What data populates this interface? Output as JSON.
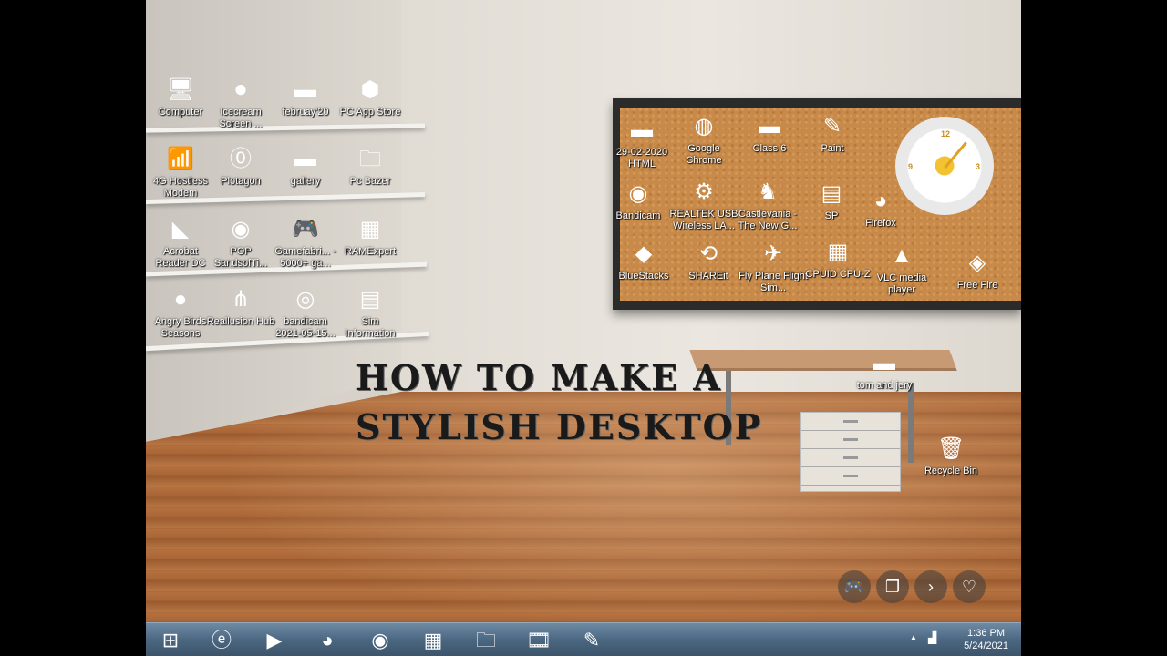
{
  "headline": {
    "line1": "HOW TO MAKE A",
    "line2": "STYLISH DESKTOP"
  },
  "shelf_icons": [
    {
      "label": "Computer",
      "glyph": "🖥",
      "icon": "computer-icon"
    },
    {
      "label": "Icecream Screen ...",
      "glyph": "⏺",
      "icon": "icecream-icon"
    },
    {
      "label": "februay'20",
      "glyph": "▬",
      "icon": "drive-icon"
    },
    {
      "label": "PC App Store",
      "glyph": "⬢",
      "icon": "app-store-icon"
    },
    {
      "label": "4G Hostless Modem",
      "glyph": "📶",
      "icon": "modem-icon"
    },
    {
      "label": "Plotagon",
      "glyph": "⓪",
      "icon": "plotagon-icon"
    },
    {
      "label": "gallery",
      "glyph": "▬",
      "icon": "drive-icon"
    },
    {
      "label": "Pc Bazer",
      "glyph": "🗀",
      "icon": "folder-icon"
    },
    {
      "label": "Acrobat Reader DC",
      "glyph": "◣",
      "icon": "acrobat-icon"
    },
    {
      "label": "POP SandsofTi...",
      "glyph": "◉",
      "icon": "pop-game-icon"
    },
    {
      "label": "Gamefabri... - 5000+ ga...",
      "glyph": "🎮",
      "icon": "gamepad-icon"
    },
    {
      "label": "RAMExpert",
      "glyph": "▦",
      "icon": "ram-icon"
    },
    {
      "label": "Angry Birds Seasons",
      "glyph": "●",
      "icon": "angry-birds-icon"
    },
    {
      "label": "Reallusion Hub",
      "glyph": "⋔",
      "icon": "reallusion-icon"
    },
    {
      "label": "bandicam 2021-05-15...",
      "glyph": "◎",
      "icon": "bandicam-file-icon"
    },
    {
      "label": "Sim Information",
      "glyph": "▤",
      "icon": "document-icon"
    }
  ],
  "board_icons": [
    {
      "label": "29-02-2020 HTML",
      "glyph": "▬",
      "icon": "drive-icon"
    },
    {
      "label": "Google Chrome",
      "glyph": "◍",
      "icon": "chrome-icon"
    },
    {
      "label": "Class 6",
      "glyph": "▬",
      "icon": "drive-icon"
    },
    {
      "label": "Paint",
      "glyph": "✎",
      "icon": "paint-icon"
    },
    {
      "label": "Bandicam",
      "glyph": "◉",
      "icon": "bandicam-icon"
    },
    {
      "label": "REALTEK USB Wireless LA...",
      "glyph": "⚙",
      "icon": "wireless-icon"
    },
    {
      "label": "Castlevania - The New G...",
      "glyph": "♞",
      "icon": "castlevania-icon"
    },
    {
      "label": "SP",
      "glyph": "▤",
      "icon": "document-icon"
    },
    {
      "label": "Firefox",
      "glyph": "◕",
      "icon": "firefox-icon"
    },
    {
      "label": "BlueStacks",
      "glyph": "◆",
      "icon": "bluestacks-icon"
    },
    {
      "label": "SHAREit",
      "glyph": "⟲",
      "icon": "shareit-icon"
    },
    {
      "label": "Fly Plane Flight Sim...",
      "glyph": "✈",
      "icon": "plane-icon"
    },
    {
      "label": "CPUID CPU-Z",
      "glyph": "▦",
      "icon": "cpuz-icon"
    },
    {
      "label": "VLC media player",
      "glyph": "▲",
      "icon": "vlc-icon"
    },
    {
      "label": "Free Fire",
      "glyph": "◈",
      "icon": "free-fire-icon"
    }
  ],
  "desk_icons": [
    {
      "label": "tom and jery",
      "glyph": "▬",
      "icon": "laptop-icon"
    },
    {
      "label": "Recycle Bin",
      "glyph": "🗑",
      "icon": "recycle-bin-icon"
    }
  ],
  "clock_face": {
    "n12": "12",
    "n3": "3",
    "n9": "9"
  },
  "taskbar": {
    "start": "⊞",
    "apps": [
      {
        "glyph": "ⓔ",
        "icon": "ie-icon"
      },
      {
        "glyph": "▶",
        "icon": "media-player-icon"
      },
      {
        "glyph": "◕",
        "icon": "firefox-icon"
      },
      {
        "glyph": "◉",
        "icon": "bandicam-icon"
      },
      {
        "glyph": "▦",
        "icon": "app-grid-icon"
      },
      {
        "glyph": "🗀",
        "icon": "explorer-icon"
      },
      {
        "glyph": "🎞",
        "icon": "movie-maker-icon"
      },
      {
        "glyph": "✎",
        "icon": "paint-icon"
      }
    ],
    "tray_arrow": "▲",
    "time": "1:36 PM",
    "date": "5/24/2021"
  },
  "overlay_controls": [
    {
      "glyph": "🎮",
      "name": "gamepad-icon"
    },
    {
      "glyph": "❐",
      "name": "copy-icon"
    },
    {
      "glyph": "›",
      "name": "next-icon"
    },
    {
      "glyph": "♡",
      "name": "heart-icon"
    }
  ],
  "colors": {
    "taskbar": "#4b6680",
    "cork": "#c88a4a",
    "floor": "#a86536"
  }
}
